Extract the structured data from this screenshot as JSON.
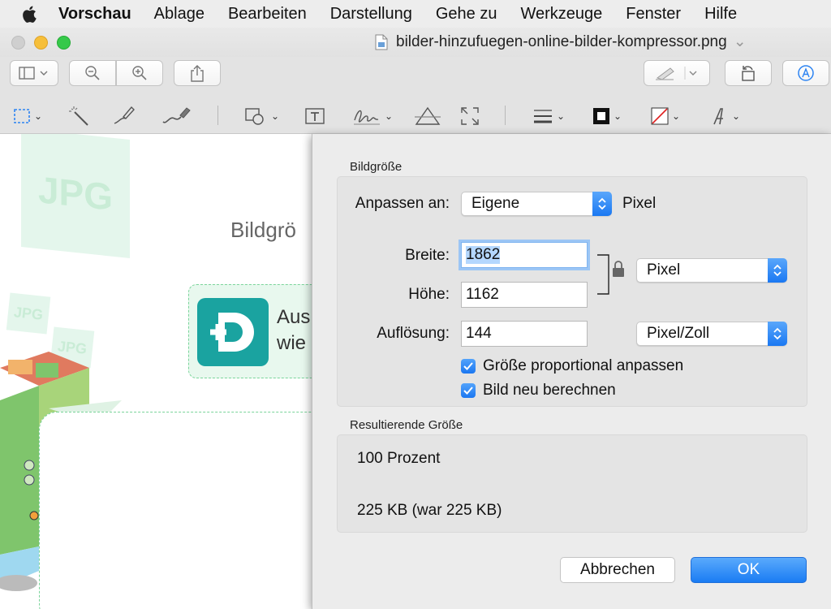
{
  "menubar": {
    "app_name": "Vorschau",
    "items": [
      "Ablage",
      "Bearbeiten",
      "Darstellung",
      "Gehe zu",
      "Werkzeuge",
      "Fenster",
      "Hilfe"
    ]
  },
  "window": {
    "title": "bilder-hinzufuegen-online-bilder-kompressor.png"
  },
  "background_page": {
    "jpg_label": "JPG",
    "heading_fragment": "Bildgrö",
    "promo_text_line1": "Aus",
    "promo_text_line2": "wie"
  },
  "dialog": {
    "section_size": "Bildgröße",
    "fit_label": "Anpassen an:",
    "fit_value": "Eigene",
    "fit_unit": "Pixel",
    "width_label": "Breite:",
    "width_value": "1862",
    "height_label": "Höhe:",
    "height_value": "1162",
    "size_unit": "Pixel",
    "resolution_label": "Auflösung:",
    "resolution_value": "144",
    "resolution_unit": "Pixel/Zoll",
    "scale_proportional": "Größe proportional anpassen",
    "resample": "Bild neu berechnen",
    "section_result": "Resultierende Größe",
    "result_percent": "100 Prozent",
    "result_size": "225 KB (war 225 KB)",
    "cancel_label": "Abbrechen",
    "ok_label": "OK"
  },
  "colors": {
    "accent": "#1a7cf3",
    "menubar_bg": "#ededed",
    "sheet_bg": "#ececec",
    "promo_green": "#1aa3a0"
  }
}
